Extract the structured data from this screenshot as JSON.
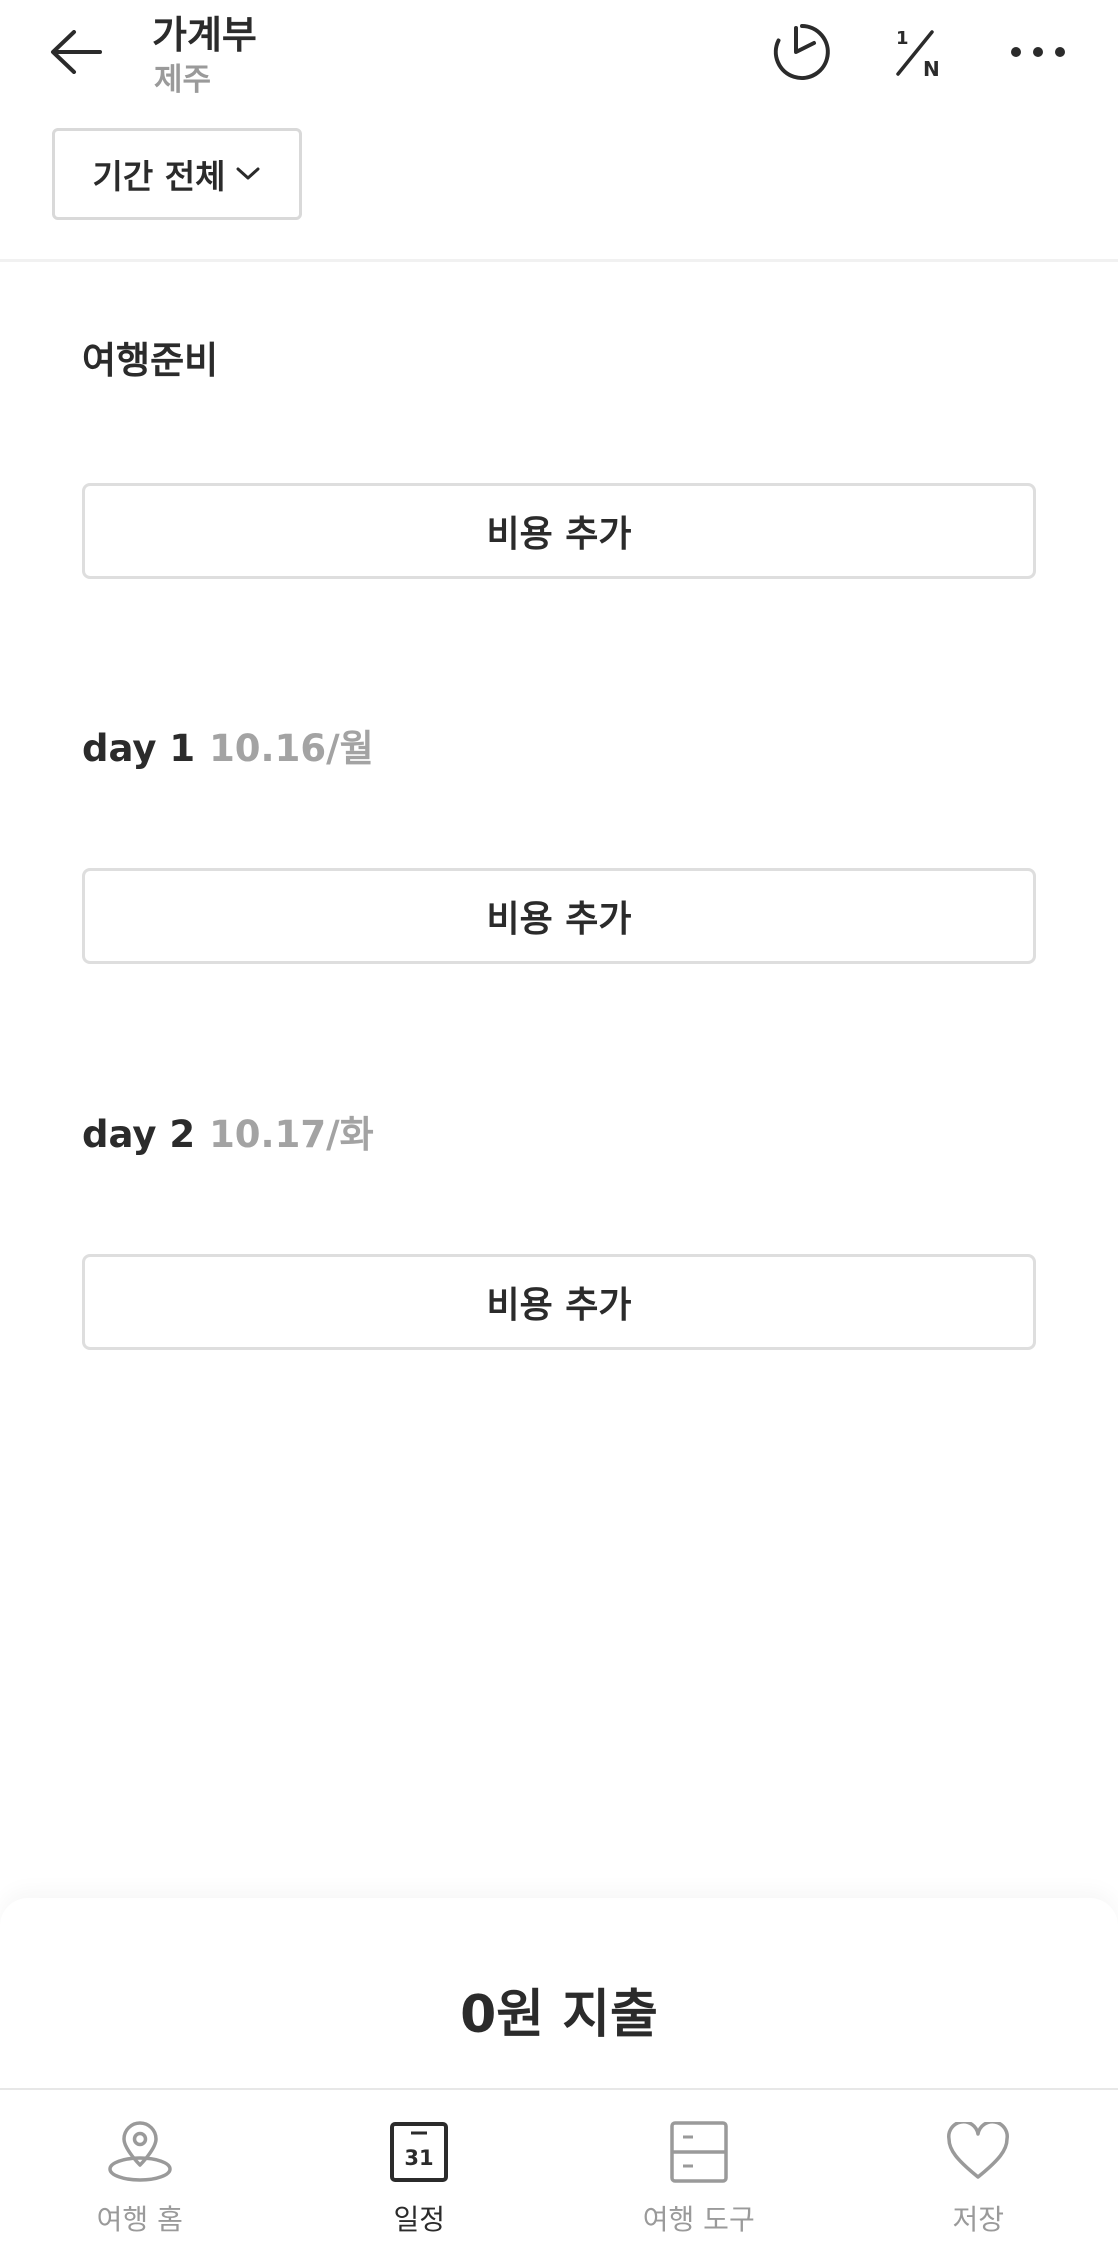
{
  "header": {
    "title": "가계부",
    "subtitle": "제주",
    "split_icon_label": "1/N",
    "icons": [
      "back-arrow-icon",
      "pie-chart-icon",
      "split-bill-icon",
      "more-icon"
    ]
  },
  "filter": {
    "period_label": "기간 전체",
    "icon": "chevron-down-icon"
  },
  "sections": [
    {
      "title": "여행준비",
      "date": "",
      "add_label": "비용 추가"
    },
    {
      "title": "day 1",
      "date": "10.16/월",
      "add_label": "비용 추가"
    },
    {
      "title": "day 2",
      "date": "10.17/화",
      "add_label": "비용 추가"
    }
  ],
  "summary": {
    "total_label": "0원 지출"
  },
  "bottom_nav": {
    "items": [
      {
        "label": "여행 홈",
        "icon": "map-pin-icon",
        "active": false
      },
      {
        "label": "일정",
        "icon": "calendar-icon",
        "icon_text": "31",
        "active": true
      },
      {
        "label": "여행 도구",
        "icon": "drawer-icon",
        "active": false
      },
      {
        "label": "저장",
        "icon": "heart-icon",
        "active": false
      }
    ]
  },
  "colors": {
    "text_primary": "#2b2b2b",
    "text_secondary": "#9a9a9a",
    "border": "#dedede",
    "background": "#ffffff"
  }
}
